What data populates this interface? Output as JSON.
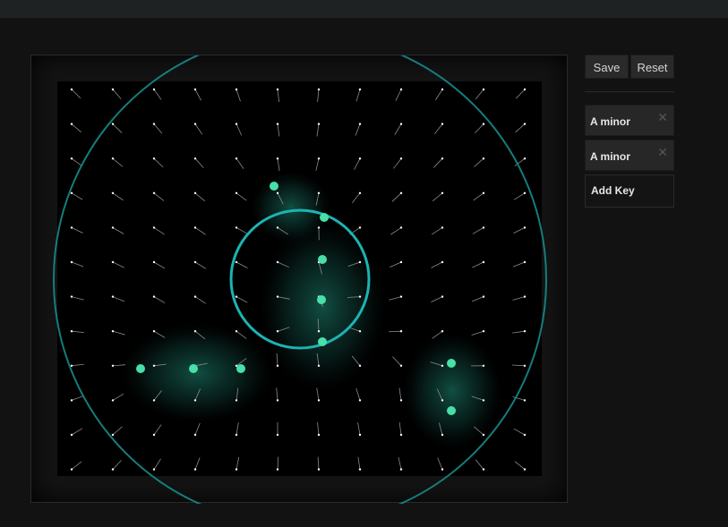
{
  "toolbar": {
    "save_label": "Save",
    "reset_label": "Reset"
  },
  "keys": [
    {
      "label": "A minor",
      "remove_icon": "close-icon"
    },
    {
      "label": "A minor",
      "remove_icon": "close-icon"
    }
  ],
  "add_key_label": "Add Key",
  "colors": {
    "accent": "#1fa3a3",
    "node": "#48e0a8",
    "glow": "#1e8f7a",
    "field_bg": "#000000"
  }
}
